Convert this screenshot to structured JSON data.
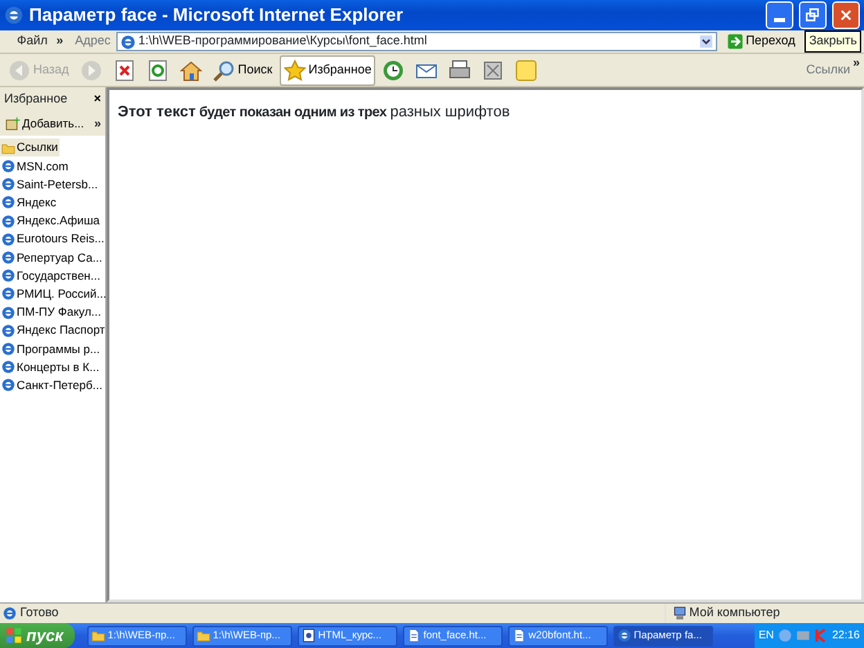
{
  "window": {
    "title": "Параметр face - Microsoft Internet Explorer"
  },
  "menu_bar": {
    "items": [
      "Файл"
    ],
    "chevron": "»"
  },
  "address_bar": {
    "label": "Адрес",
    "value": "1:\\h\\WEB-программирование\\Курсы\\font_face.html",
    "go": "Переход",
    "tooltip": "Закрыть"
  },
  "toolbar": {
    "buttons": [
      {
        "kind": "back",
        "label": "Назад",
        "disabled": true,
        "selected": false
      },
      {
        "kind": "forward",
        "disabled": true,
        "selected": false
      },
      {
        "kind": "stop",
        "disabled": false,
        "selected": false
      },
      {
        "kind": "refresh",
        "disabled": false,
        "selected": false
      },
      {
        "kind": "home",
        "disabled": false,
        "selected": false
      },
      {
        "kind": "search",
        "label": "Поиск",
        "disabled": false,
        "selected": false
      },
      {
        "kind": "favorites",
        "label": "Избранное",
        "disabled": false,
        "selected": true
      },
      {
        "kind": "history",
        "disabled": false,
        "selected": false
      },
      {
        "kind": "mail",
        "disabled": false,
        "selected": false
      },
      {
        "kind": "print",
        "disabled": false,
        "selected": false
      },
      {
        "kind": "edit",
        "disabled": false,
        "selected": false
      },
      {
        "kind": "note",
        "disabled": false,
        "selected": false
      }
    ],
    "links_label": "Ссылки",
    "chevron": "»"
  },
  "sidebar": {
    "title": "Избранное",
    "close": "×",
    "add": "Добавить...",
    "add_chevron": "»",
    "items": [
      {
        "kind": "folder",
        "label": "Ссылки",
        "selected": true
      },
      {
        "kind": "link",
        "label": "MSN.com",
        "selected": false
      },
      {
        "kind": "link",
        "label": "Saint-Petersb...",
        "selected": false
      },
      {
        "kind": "link",
        "label": "Яндекс",
        "selected": false
      },
      {
        "kind": "link",
        "label": "Яндекс.Афиша",
        "selected": false
      },
      {
        "kind": "link",
        "label": "Eurotours Reis...",
        "selected": false
      },
      {
        "kind": "link",
        "label": "Репертуар Са...",
        "selected": false
      },
      {
        "kind": "link",
        "label": "Государствен...",
        "selected": false
      },
      {
        "kind": "link",
        "label": "РМИЦ. Россий...",
        "selected": false
      },
      {
        "kind": "link",
        "label": "ПМ-ПУ  Факул...",
        "selected": false
      },
      {
        "kind": "link",
        "label": "Яндекс Паспорт",
        "selected": false
      },
      {
        "kind": "link",
        "label": "Программы р...",
        "selected": false
      },
      {
        "kind": "link",
        "label": "Концерты в К...",
        "selected": false
      },
      {
        "kind": "link",
        "label": "Санкт-Петерб...",
        "selected": false
      }
    ]
  },
  "content": {
    "segments": [
      {
        "kind": "bold",
        "text": "Этот текст"
      },
      {
        "kind": "narrow-bold",
        "text": "будет показан одним из трех"
      },
      {
        "kind": "plain",
        "text": "разных шрифтов"
      }
    ]
  },
  "status_bar": {
    "text": "Готово",
    "zone": "Мой компьютер"
  },
  "taskbar": {
    "start": "пуск",
    "tasks": [
      {
        "kind": "folder",
        "label": "1:\\h\\WEB-пр...",
        "selected": false
      },
      {
        "kind": "folder",
        "label": "1:\\h\\WEB-пр...",
        "selected": false
      },
      {
        "kind": "doc",
        "label": "HTML_курс...",
        "selected": false
      },
      {
        "kind": "page",
        "label": "font_face.ht...",
        "selected": false
      },
      {
        "kind": "page",
        "label": "w20bfont.ht...",
        "selected": false
      },
      {
        "kind": "ie",
        "label": "Параметр fa...",
        "selected": true
      }
    ],
    "language": "EN",
    "clock": "22:16"
  }
}
